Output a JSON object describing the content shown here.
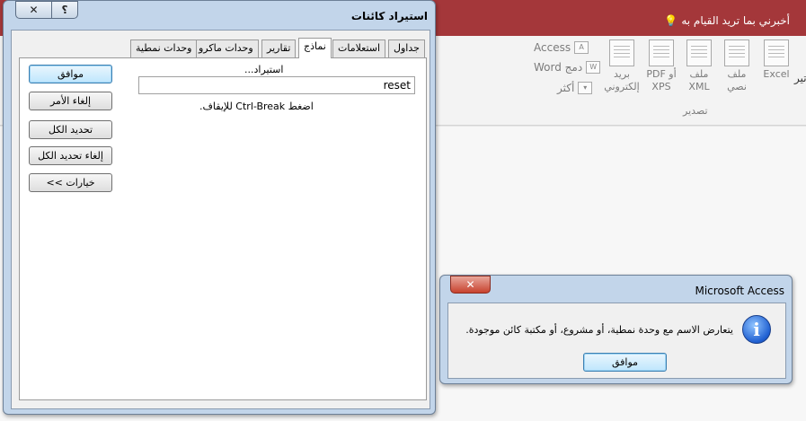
{
  "app": {
    "tell_me": "أخبرني بما تريد القيام به",
    "clipped_label": "تير"
  },
  "ribbon": {
    "export_group_label": "تصدير",
    "big_buttons": [
      {
        "label": "Excel",
        "icon": "excel-icon"
      },
      {
        "label": "ملف نصي",
        "icon": "text-file-icon"
      },
      {
        "label": "ملف XML",
        "icon": "xml-file-icon"
      },
      {
        "label": "PDF أو XPS",
        "icon": "pdf-xps-icon"
      },
      {
        "label": "بريد إلكتروني",
        "icon": "email-icon"
      }
    ],
    "small_buttons": [
      {
        "label": "Access",
        "icon": "access-icon"
      },
      {
        "label": "دمج Word",
        "icon": "word-merge-icon"
      },
      {
        "label": "أكثر",
        "icon": "more-icon"
      }
    ]
  },
  "import_dialog": {
    "title": "استيراد كائنات",
    "help_glyph": "؟",
    "close_glyph": "✕",
    "tabs": [
      "جداول",
      "استعلامات",
      "نماذج",
      "تقارير",
      "وحدات ماكرو",
      "وحدات نمطية"
    ],
    "active_tab_index": 2,
    "importing_label": "استيراد...",
    "reset_value": "reset",
    "stop_hint": "اضغط Ctrl-Break للإيقاف.",
    "buttons": {
      "ok": "موافق",
      "cancel": "إلغاء الأمر",
      "select_all": "تحديد الكل",
      "deselect_all": "إلغاء تحديد الكل",
      "options": "خيارات >>"
    }
  },
  "message_box": {
    "title": "Microsoft Access",
    "close_glyph": "✕",
    "icon_glyph": "i",
    "text": "يتعارض الاسم مع وحدة نمطية، أو مشروع، أو مكتبة كائن موجودة.",
    "ok": "موافق"
  },
  "colors": {
    "ribbon_header": "#a4373a",
    "dialog_frame": "#c2d5ea",
    "close_red": "#c7422e"
  }
}
